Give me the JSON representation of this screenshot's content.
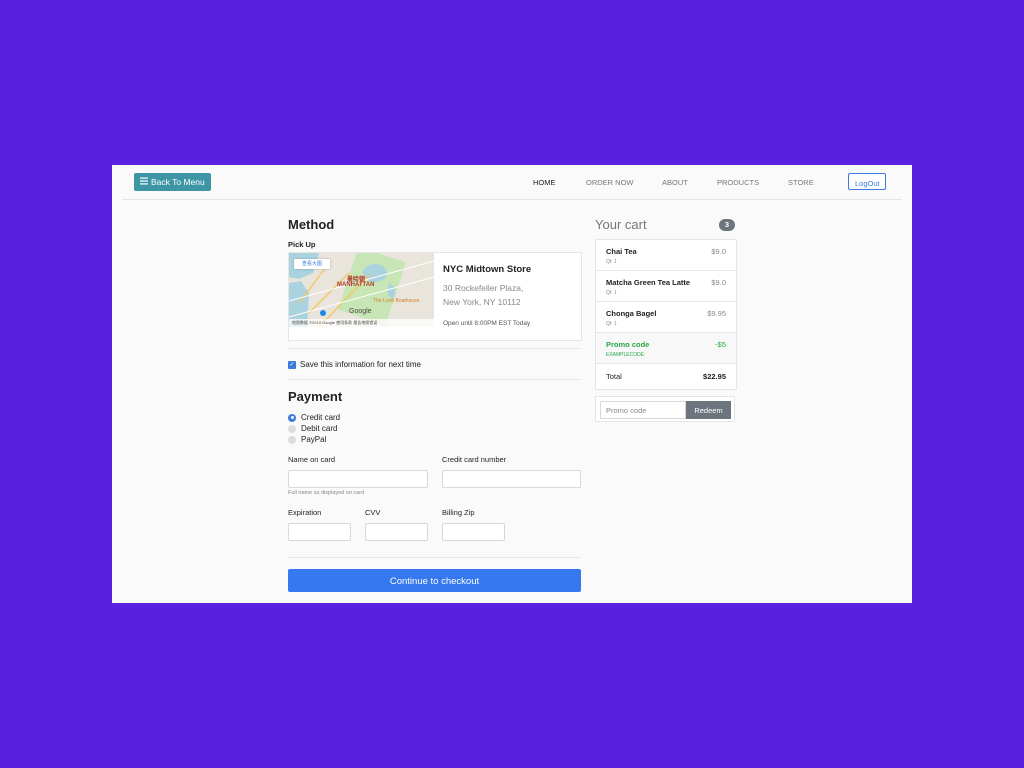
{
  "nav": {
    "back_label": "Back To Menu",
    "links": [
      {
        "label": "HOME",
        "active": true
      },
      {
        "label": "ORDER NOW",
        "active": false
      },
      {
        "label": "ABOUT",
        "active": false
      },
      {
        "label": "PRODUCTS",
        "active": false
      },
      {
        "label": "STORE",
        "active": false
      }
    ],
    "logout_label": "LogOut"
  },
  "method": {
    "title": "Method",
    "pickup_label": "Pick Up",
    "map": {
      "view_larger_label": "查看大图",
      "labels": [
        "曼哈顿",
        "MANHATTAN",
        "The Loeb Boathouse"
      ],
      "google_label": "Google",
      "footer_text": "地图数据 ©2019 Google 使用条款 报告地图错误"
    },
    "store": {
      "name": "NYC Midtown Store",
      "address_line1": "30 Rockefeller Plaza,",
      "address_line2": "New York, NY 10112",
      "hours": "Open until 8:00PM EST Today"
    },
    "save_info_label": "Save this information for next time",
    "save_info_checked": true
  },
  "payment": {
    "title": "Payment",
    "options": [
      {
        "label": "Credit card",
        "selected": true
      },
      {
        "label": "Debit card",
        "selected": false
      },
      {
        "label": "PayPal",
        "selected": false
      }
    ],
    "name_on_card_label": "Name on card",
    "name_on_card_hint": "Full name as displayed on card",
    "card_number_label": "Credit card number",
    "expiration_label": "Expiration",
    "cvv_label": "CVV",
    "billing_zip_label": "Billing Zip",
    "checkout_label": "Continue to checkout"
  },
  "cart": {
    "title": "Your cart",
    "count": "3",
    "items": [
      {
        "name": "Chai Tea",
        "qty": "Qt: 1",
        "price": "$9.0"
      },
      {
        "name": "Matcha Green Tea Latte",
        "qty": "Qt: 1",
        "price": "$9.0"
      },
      {
        "name": "Chonga Bagel",
        "qty": "Qt: 1",
        "price": "$9.95"
      }
    ],
    "promo": {
      "label": "Promo code",
      "code": "EXAMPLECODE",
      "amount": "-$5"
    },
    "total_label": "Total",
    "total_value": "$22.95",
    "promo_input_placeholder": "Promo code",
    "redeem_label": "Redeem"
  },
  "colors": {
    "background": "#5a20e0",
    "primary": "#3578f0",
    "back_button": "#3d95a5",
    "promo_green": "#28a745",
    "muted_button": "#6c757d"
  }
}
